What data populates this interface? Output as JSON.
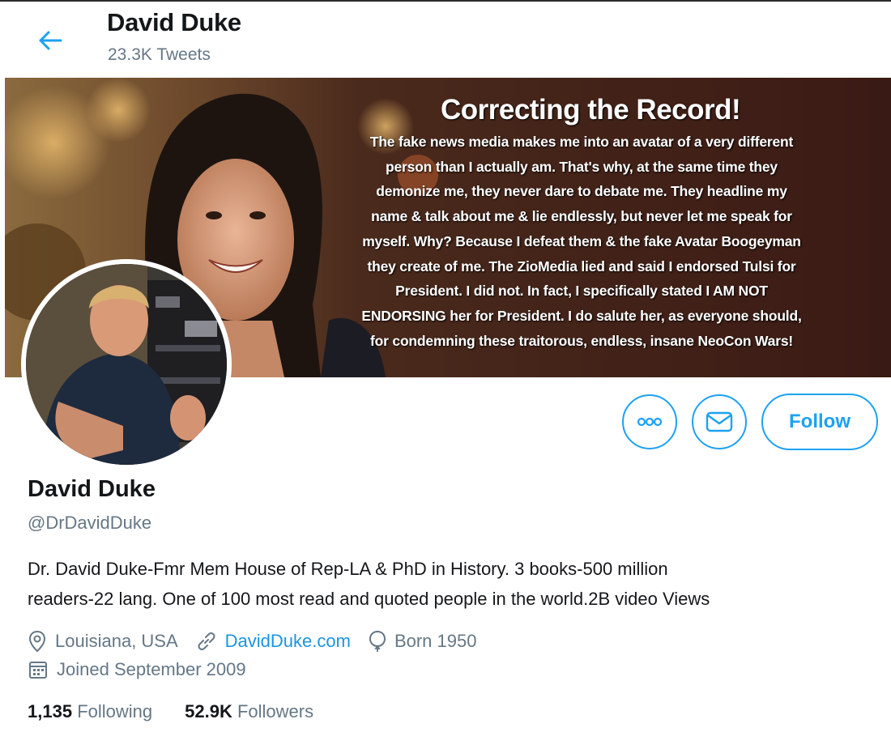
{
  "header": {
    "name": "David Duke",
    "tweet_count": "23.3K Tweets"
  },
  "banner": {
    "title": "Correcting the Record!",
    "lines": [
      "The fake news media makes me into an avatar of a very different",
      "person than I actually am. That's why, at the same time they",
      "demonize me, they never dare to debate me. They headline my",
      "name & talk about me  & lie endlessly, but never let me speak for",
      "myself. Why? Because I defeat them & the fake Avatar Boogeyman",
      "they create of me. The ZioMedia lied and said I endorsed Tulsi  for",
      "President. I did not. In fact, I specifically stated I AM NOT",
      "ENDORSING her for President. I do salute her, as everyone should,",
      "for condemning these traitorous, endless, insane NeoCon Wars!"
    ]
  },
  "actions": {
    "follow_label": "Follow"
  },
  "profile": {
    "name": "David Duke",
    "handle": "@DrDavidDuke",
    "bio_line1": "Dr. David Duke-Fmr Mem House of Rep-LA & PhD in History. 3 books-500 million",
    "bio_line2": "readers-22 lang. One of 100 most read and quoted people in the world.2B video Views",
    "location": "Louisiana, USA",
    "website": "DavidDuke.com",
    "born": "Born 1950",
    "joined": "Joined September 2009"
  },
  "stats": {
    "following_count": "1,135",
    "following_label": "Following",
    "followers_count": "52.9K",
    "followers_label": "Followers"
  },
  "colors": {
    "accent": "#1da1f2",
    "secondary_text": "#657786",
    "banner_bg": "#3a1e16"
  }
}
